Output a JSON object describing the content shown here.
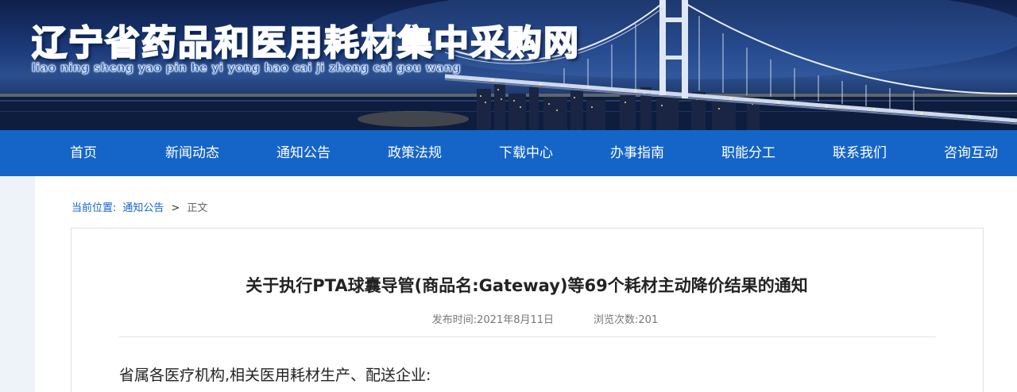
{
  "site": {
    "title": "辽宁省药品和医用耗材集中采购网",
    "pinyin": "liao ning sheng yao pin he yi yong hao cai ji zhong cai gou wang"
  },
  "nav": {
    "items": [
      {
        "label": "首页"
      },
      {
        "label": "新闻动态"
      },
      {
        "label": "通知公告"
      },
      {
        "label": "政策法规"
      },
      {
        "label": "下载中心"
      },
      {
        "label": "办事指南"
      },
      {
        "label": "职能分工"
      },
      {
        "label": "联系我们"
      },
      {
        "label": "咨询互动"
      }
    ]
  },
  "breadcrumb": {
    "label": "当前位置:",
    "link": "通知公告",
    "separator": ">",
    "current": "正文"
  },
  "article": {
    "title": "关于执行PTA球囊导管(商品名:Gateway)等69个耗材主动降价结果的通知",
    "published": "发布时间:2021年8月11日",
    "views": "浏览次数:201",
    "greeting": "省属各医疗机构,相关医用耗材生产、配送企业:"
  },
  "colors": {
    "nav_bg": "#1565c9",
    "link": "#1565c9",
    "content_bg": "#eef3f9"
  }
}
